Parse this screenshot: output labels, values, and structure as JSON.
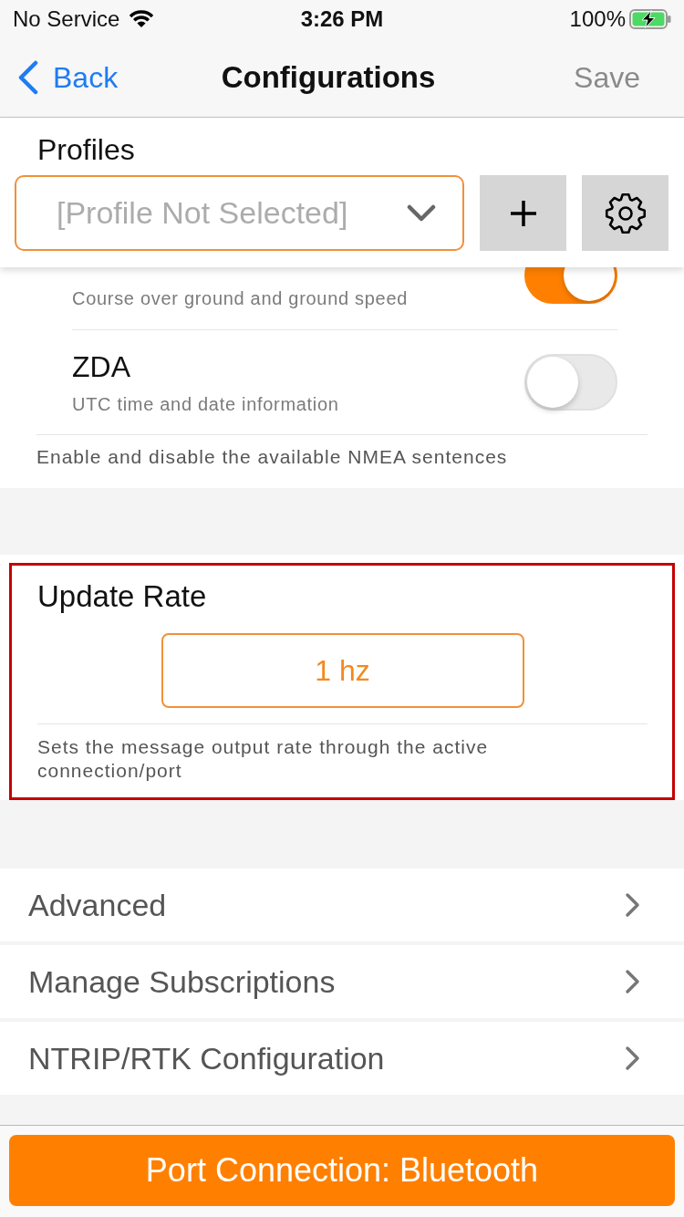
{
  "status_bar": {
    "carrier": "No Service",
    "time": "3:26 PM",
    "battery": "100%"
  },
  "nav_bar": {
    "back": "Back",
    "title": "Configurations",
    "save": {
      "label": "Save",
      "disabled": true
    }
  },
  "profiles": {
    "label": "Profiles",
    "placeholder": "[Profile Not Selected]"
  },
  "nmea": {
    "sentences": [
      {
        "kind": "cut_off",
        "description": "Course over ground and ground speed",
        "on": true
      },
      {
        "kind": "row",
        "name": "ZDA",
        "description": "UTC time and date information",
        "on": false
      }
    ],
    "footer": "Enable and disable the available NMEA sentences"
  },
  "update_rate": {
    "title": "Update Rate",
    "value": "1 hz",
    "description": "Sets the message output rate through the active connection/port",
    "highlighted": true
  },
  "menu": [
    {
      "label": "Advanced"
    },
    {
      "label": "Manage Subscriptions"
    },
    {
      "label": "NTRIP/RTK Configuration"
    }
  ],
  "port_button": {
    "label": "Port Connection: Bluetooth"
  }
}
